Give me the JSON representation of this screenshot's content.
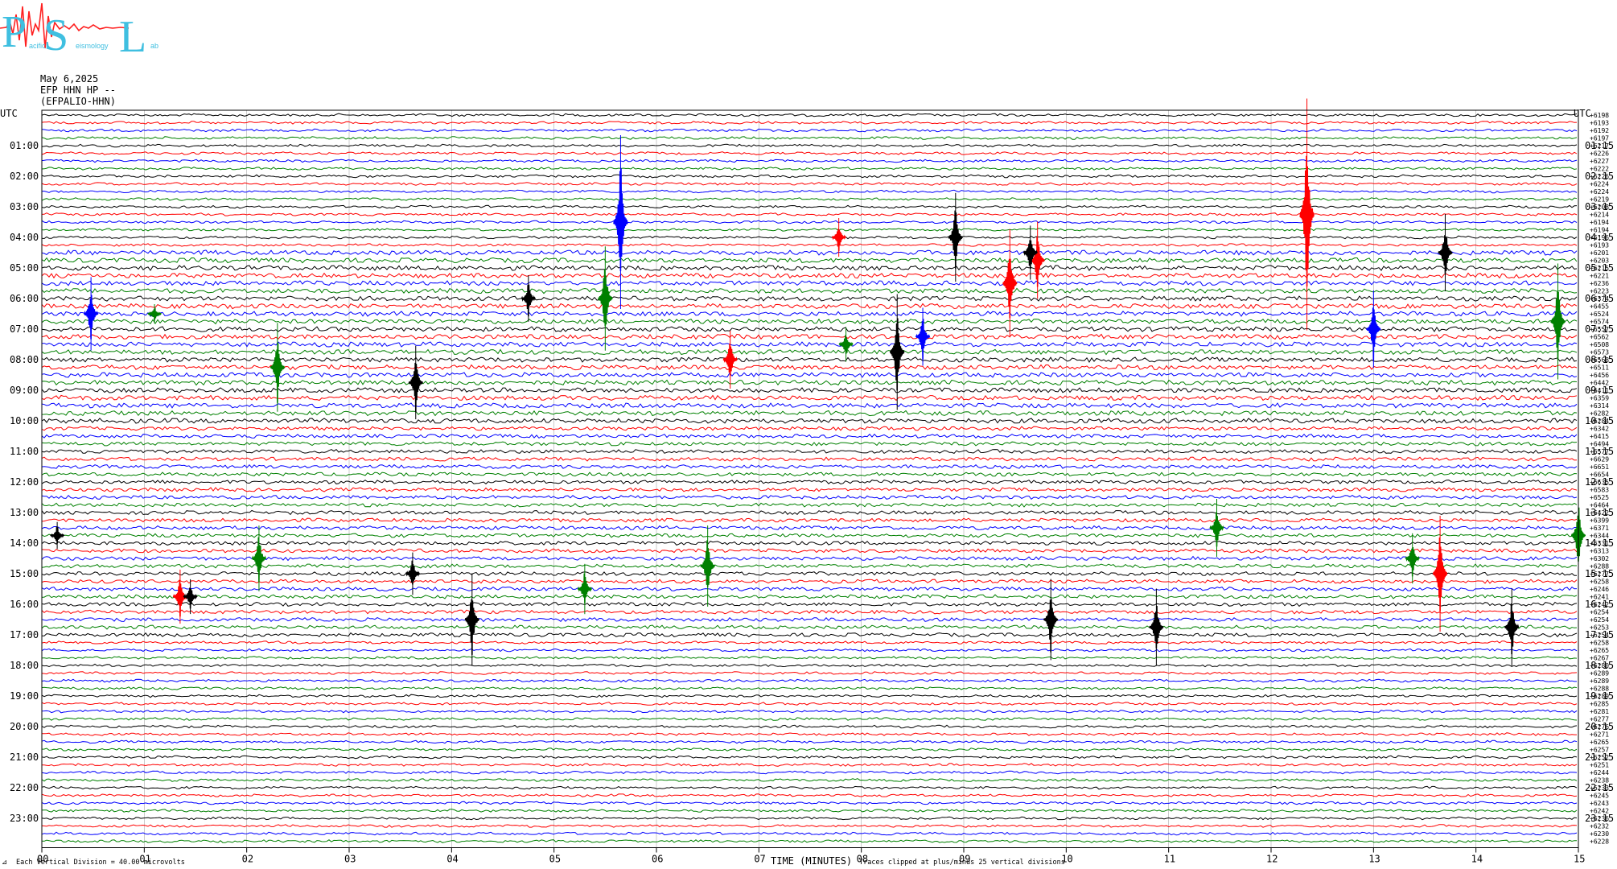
{
  "logo": {
    "letters": [
      "P",
      "S",
      "L"
    ],
    "words": [
      "acific",
      "eismology",
      "ab"
    ],
    "colors": {
      "letters": "#3fbfe0",
      "wave": "#ff2020"
    }
  },
  "header": {
    "date": "May 6,2025",
    "channel": "EFP HHN HP --",
    "station": "(EFPALIO-HHN)"
  },
  "left_axis_title": "UTC",
  "right_axis_title": "UTC",
  "footer": {
    "left_mark": "⊿",
    "vertical_division": "Each Vertical Division =   40.00 microvolts",
    "xlabel": "TIME (MINUTES)",
    "clip_note": "Traces clipped at plus/minus 25 vertical divisions"
  },
  "chart_data": {
    "type": "line",
    "title": "",
    "xlabel": "TIME (MINUTES)",
    "x_ticks": [
      "00",
      "01",
      "02",
      "03",
      "04",
      "05",
      "06",
      "07",
      "08",
      "09",
      "10",
      "11",
      "12",
      "13",
      "14",
      "15"
    ],
    "xlim": [
      0,
      15
    ],
    "left_hour_labels": [
      "01:00",
      "02:00",
      "03:00",
      "04:00",
      "05:00",
      "06:00",
      "07:00",
      "08:00",
      "09:00",
      "10:00",
      "11:00",
      "12:00",
      "13:00",
      "14:00",
      "15:00",
      "16:00",
      "17:00",
      "18:00",
      "19:00",
      "20:00",
      "21:00",
      "22:00",
      "23:00"
    ],
    "right_hour_labels": [
      "01:15",
      "02:15",
      "03:15",
      "04:15",
      "05:15",
      "06:15",
      "07:15",
      "08:15",
      "09:15",
      "10:15",
      "11:15",
      "12:15",
      "13:15",
      "14:15",
      "15:15",
      "16:15",
      "17:15",
      "18:15",
      "19:15",
      "20:15",
      "21:15",
      "22:15",
      "23:15"
    ],
    "trace_count": 96,
    "minutes_per_trace": 15,
    "trace_color_cycle": [
      "#000000",
      "#ff0000",
      "#0000ff",
      "#008000"
    ],
    "right_offsets": [
      "+6198",
      "+6193",
      "+6192",
      "+6197",
      "+6217",
      "+6226",
      "+6227",
      "+6222",
      "+6226",
      "+6224",
      "+6224",
      "+6219",
      "+6208",
      "+6214",
      "+6194",
      "+6194",
      "+6196",
      "+6193",
      "+6201",
      "+6203",
      "+6215",
      "+6221",
      "+6236",
      "+6223",
      "+6374",
      "+6455",
      "+6524",
      "+6574",
      "+6557",
      "+6562",
      "+6508",
      "+6573",
      "+6568",
      "+6511",
      "+6456",
      "+6442",
      "+6411",
      "+6359",
      "+6314",
      "+6282",
      "+6284",
      "+6342",
      "+6415",
      "+6494",
      "+6577",
      "+6629",
      "+6651",
      "+6654",
      "+6635",
      "+6583",
      "+6525",
      "+6464",
      "+6422",
      "+6399",
      "+6371",
      "+6344",
      "+6331",
      "+6313",
      "+6302",
      "+6288",
      "+6277",
      "+6258",
      "+6246",
      "+6241",
      "+6242",
      "+6254",
      "+6254",
      "+6253",
      "+6254",
      "+6258",
      "+6265",
      "+6267",
      "+6280",
      "+6289",
      "+6289",
      "+6288",
      "+6289",
      "+6285",
      "+6281",
      "+6277",
      "+6276",
      "+6271",
      "+6265",
      "+6257",
      "+6252",
      "+6251",
      "+6244",
      "+6238",
      "+6233",
      "+6245",
      "+6243",
      "+6242",
      "+6236",
      "+6232",
      "+6230",
      "+6228"
    ],
    "events": [
      {
        "minute": 0.15,
        "trace": 55,
        "amp": 14,
        "color": "#000000"
      },
      {
        "minute": 0.48,
        "trace": 26,
        "amp": 38,
        "color": "#0000ff"
      },
      {
        "minute": 1.1,
        "trace": 26,
        "amp": 10,
        "color": "#008000"
      },
      {
        "minute": 1.35,
        "trace": 63,
        "amp": 28,
        "color": "#ff0000"
      },
      {
        "minute": 1.45,
        "trace": 63,
        "amp": 18,
        "color": "#000000"
      },
      {
        "minute": 2.12,
        "trace": 58,
        "amp": 34,
        "color": "#008000"
      },
      {
        "minute": 2.3,
        "trace": 33,
        "amp": 46,
        "color": "#008000"
      },
      {
        "minute": 3.65,
        "trace": 35,
        "amp": 38,
        "color": "#000000"
      },
      {
        "minute": 3.62,
        "trace": 60,
        "amp": 22,
        "color": "#000000"
      },
      {
        "minute": 4.2,
        "trace": 66,
        "amp": 48,
        "color": "#000000"
      },
      {
        "minute": 4.75,
        "trace": 24,
        "amp": 24,
        "color": "#000000"
      },
      {
        "minute": 5.5,
        "trace": 24,
        "amp": 54,
        "color": "#008000"
      },
      {
        "minute": 5.65,
        "trace": 14,
        "amp": 90,
        "color": "#0000ff"
      },
      {
        "minute": 5.3,
        "trace": 62,
        "amp": 26,
        "color": "#008000"
      },
      {
        "minute": 6.5,
        "trace": 59,
        "amp": 42,
        "color": "#008000"
      },
      {
        "minute": 6.72,
        "trace": 32,
        "amp": 30,
        "color": "#ff0000"
      },
      {
        "minute": 7.78,
        "trace": 16,
        "amp": 20,
        "color": "#ff0000"
      },
      {
        "minute": 7.85,
        "trace": 30,
        "amp": 18,
        "color": "#008000"
      },
      {
        "minute": 8.35,
        "trace": 31,
        "amp": 60,
        "color": "#000000"
      },
      {
        "minute": 8.6,
        "trace": 29,
        "amp": 30,
        "color": "#0000ff"
      },
      {
        "minute": 8.92,
        "trace": 16,
        "amp": 46,
        "color": "#000000"
      },
      {
        "minute": 9.45,
        "trace": 22,
        "amp": 56,
        "color": "#ff0000"
      },
      {
        "minute": 9.72,
        "trace": 19,
        "amp": 40,
        "color": "#ff0000"
      },
      {
        "minute": 9.65,
        "trace": 18,
        "amp": 28,
        "color": "#000000"
      },
      {
        "minute": 9.85,
        "trace": 66,
        "amp": 42,
        "color": "#000000"
      },
      {
        "minute": 10.88,
        "trace": 67,
        "amp": 40,
        "color": "#000000"
      },
      {
        "minute": 11.47,
        "trace": 54,
        "amp": 30,
        "color": "#008000"
      },
      {
        "minute": 12.35,
        "trace": 13,
        "amp": 120,
        "color": "#ff0000"
      },
      {
        "minute": 13.0,
        "trace": 28,
        "amp": 40,
        "color": "#0000ff"
      },
      {
        "minute": 13.38,
        "trace": 58,
        "amp": 26,
        "color": "#008000"
      },
      {
        "minute": 13.65,
        "trace": 60,
        "amp": 60,
        "color": "#ff0000"
      },
      {
        "minute": 13.7,
        "trace": 18,
        "amp": 40,
        "color": "#000000"
      },
      {
        "minute": 14.35,
        "trace": 67,
        "amp": 40,
        "color": "#000000"
      },
      {
        "minute": 14.8,
        "trace": 27,
        "amp": 60,
        "color": "#008000"
      },
      {
        "minute": 15.0,
        "trace": 55,
        "amp": 46,
        "color": "#008000"
      }
    ]
  }
}
